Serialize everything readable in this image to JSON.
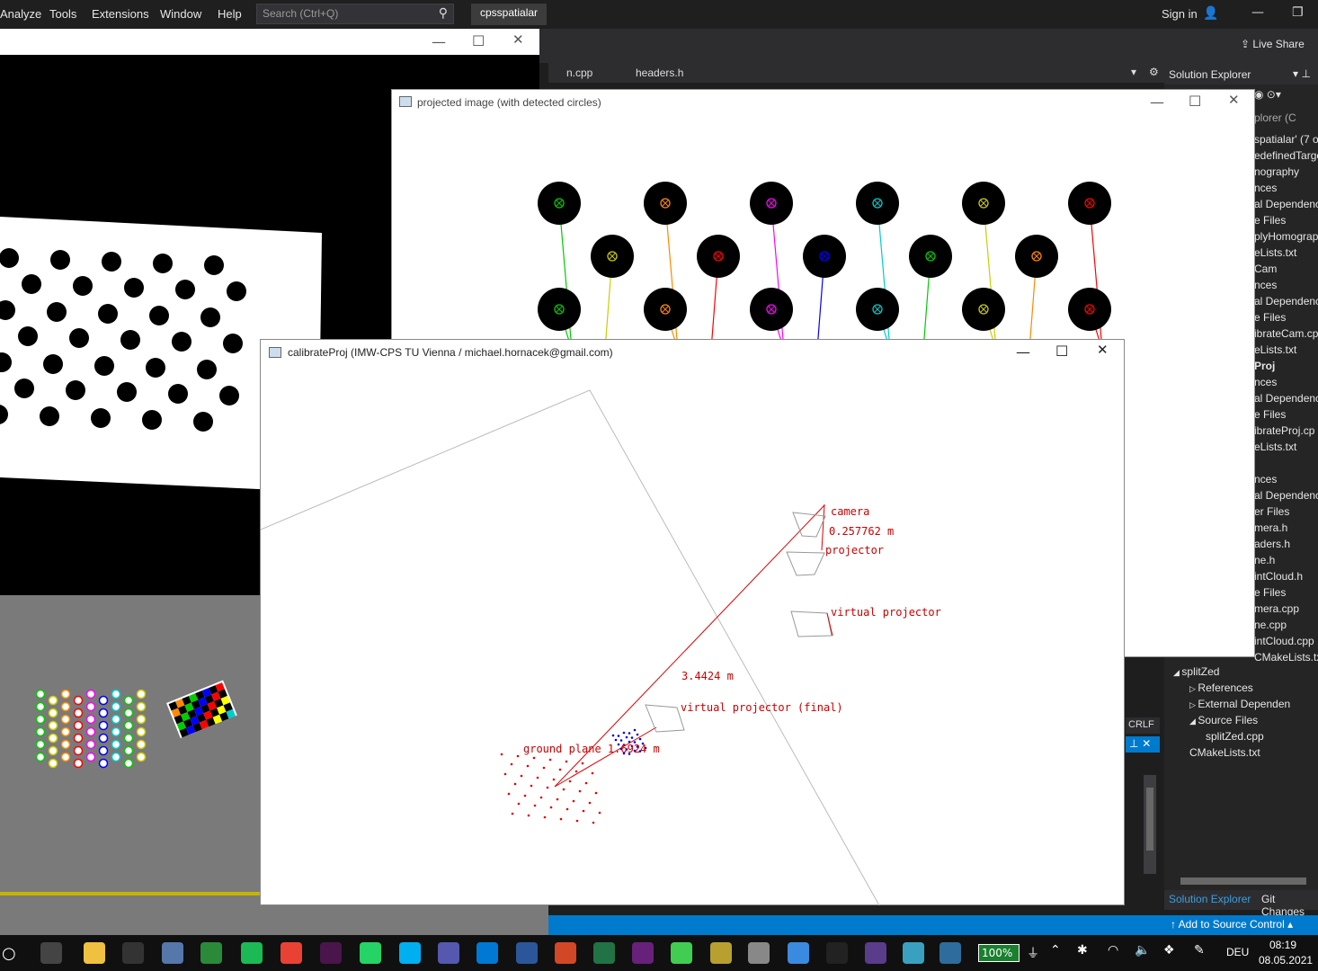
{
  "menubar": {
    "items": [
      "Analyze",
      "Tools",
      "Extensions",
      "Window",
      "Help"
    ],
    "search_placeholder": "Search (Ctrl+Q)",
    "project": "cpsspatialar",
    "signin": "Sign in"
  },
  "toolbar": {
    "liveshare": "Live Share"
  },
  "editor": {
    "tabs": [
      "n.cpp",
      "headers.h"
    ],
    "crlf": "CRLF"
  },
  "solution_explorer": {
    "title": "Solution Explorer",
    "search_fragment": "plorer (C",
    "rows": [
      "spatialar' (7 o",
      "edefinedTarge",
      "nography",
      "nces",
      "al Dependenc",
      "e Files",
      "plyHomograp",
      "eLists.txt",
      "Cam",
      "nces",
      "al Dependenc",
      "e Files",
      "ibrateCam.cp",
      "eLists.txt",
      "Proj",
      "nces",
      "al Dependenc",
      "e Files",
      "ibrateProj.cp",
      "eLists.txt",
      "",
      "nces",
      "al Dependenc",
      "er Files",
      "mera.h",
      "aders.h",
      "ne.h",
      "intCloud.h",
      "e Files",
      "mera.cpp",
      "ne.cpp",
      "intCloud.cpp",
      "CMakeLists.txt"
    ],
    "tree": [
      {
        "label": "splitZed",
        "indent": 0
      },
      {
        "label": "References",
        "indent": 1
      },
      {
        "label": "External Dependen",
        "indent": 1
      },
      {
        "label": "Source Files",
        "indent": 1
      },
      {
        "label": "splitZed.cpp",
        "indent": 2
      },
      {
        "label": "CMakeLists.txt",
        "indent": 1
      }
    ],
    "bottom_tabs": [
      "Solution Explorer",
      "Git Changes"
    ]
  },
  "statusbar": {
    "source_control": "Add to Source Control"
  },
  "projected_window": {
    "title": "projected image (with detected circles)"
  },
  "calib_window": {
    "title": "calibrateProj (IMW-CPS TU Vienna / michael.hornacek@gmail.com)",
    "labels": {
      "camera": "camera",
      "cam_dist": "0.257762 m",
      "projector": "projector",
      "virtual_projector": "virtual projector",
      "dist_proj": "3.4424 m",
      "virtual_final": "virtual projector (final)",
      "ground_plane": "ground plane 1.6924 m"
    }
  },
  "taskbar": {
    "battery": "100%",
    "lang": "DEU",
    "time": "08:19",
    "date": "08.05.2021"
  },
  "colors": {
    "vs_blue": "#007acc",
    "red_line": "#e00000",
    "circle_colors": [
      "#00cc00",
      "#cccc00",
      "#ff8800",
      "#ff0000",
      "#ff00ff",
      "#0000ff",
      "#00cccc"
    ]
  }
}
